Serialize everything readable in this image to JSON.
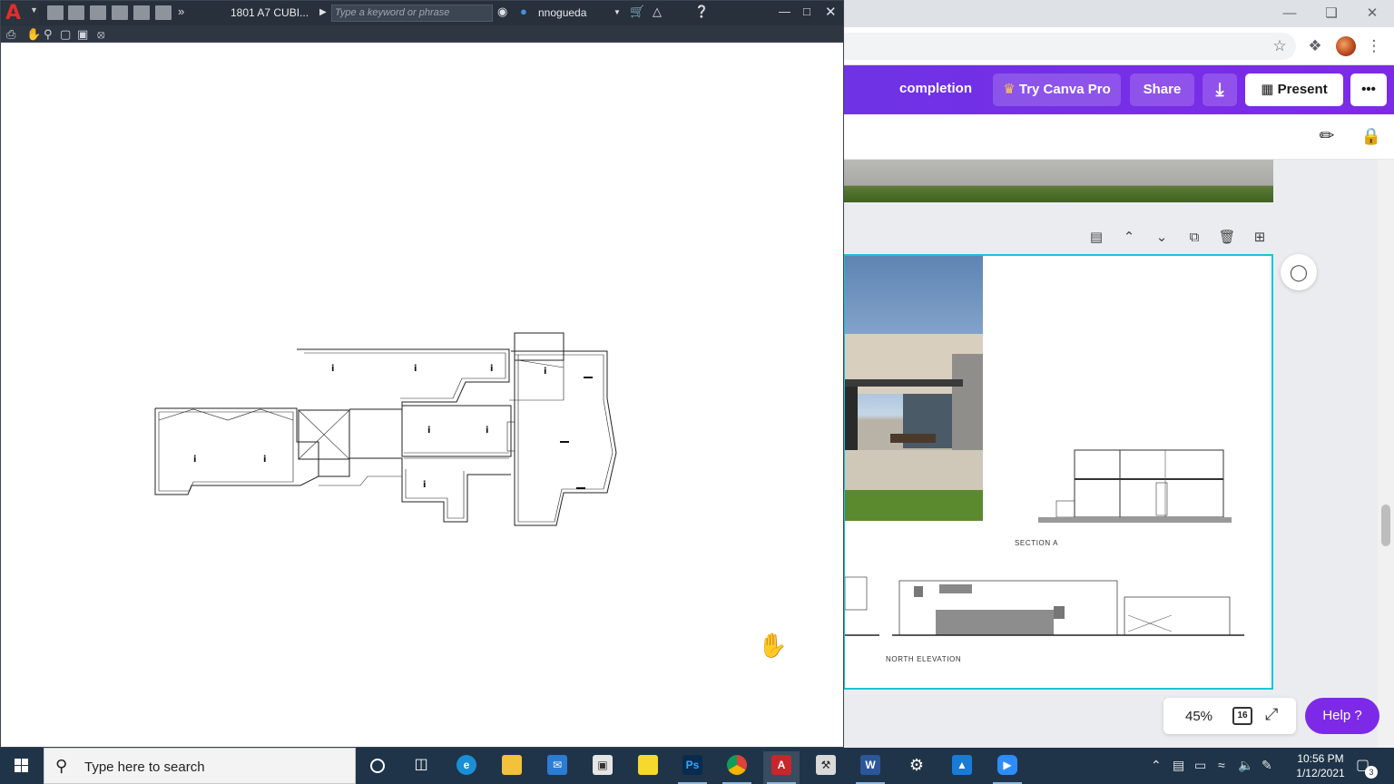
{
  "autocad": {
    "doc_title": "1801 A7 CUBI...",
    "search_placeholder": "Type a keyword or phrase",
    "username": "nnogueda",
    "icons": [
      "autocad-logo",
      "new-icon",
      "open-icon",
      "save-icon",
      "save-as-icon",
      "plot-icon",
      "share-icon",
      "more-icon",
      "binoculars-icon",
      "user-icon",
      "cart-icon",
      "autodesk-app-icon",
      "help-icon",
      "minimize-icon",
      "maximize-icon",
      "close-icon"
    ]
  },
  "browser": {
    "controls": [
      "minimize-icon",
      "restore-icon",
      "close-icon"
    ],
    "toolbar_icons": [
      "bookmark-star-icon",
      "extensions-icon",
      "profile-avatar",
      "menu-icon"
    ]
  },
  "canva": {
    "doc_title": "completion",
    "try_pro_label": "Try Canva Pro",
    "share_label": "Share",
    "present_label": "Present",
    "more_label": "•••",
    "section_label": "SECTION A",
    "elevation_label": "NORTH ELEVATION",
    "zoom": "45%",
    "page_count": "16",
    "help_label": "Help ?",
    "accent_color": "#7d2ae8",
    "selection_color": "#13c6d6"
  },
  "taskbar": {
    "search_placeholder": "Type here to search",
    "apps": [
      "cortana-icon",
      "task-view-icon",
      "edge-icon",
      "file-explorer-icon",
      "mail-icon",
      "store-icon",
      "sticky-notes-icon",
      "photoshop-icon",
      "chrome-icon",
      "autocad-icon",
      "rhino-icon",
      "word-icon",
      "settings-icon",
      "photos-icon",
      "zoom-icon"
    ],
    "photoshop_label": "Ps",
    "word_label": "W",
    "autocad_label": "A",
    "time": "10:56 PM",
    "date": "1/12/2021",
    "notification_count": "3"
  }
}
